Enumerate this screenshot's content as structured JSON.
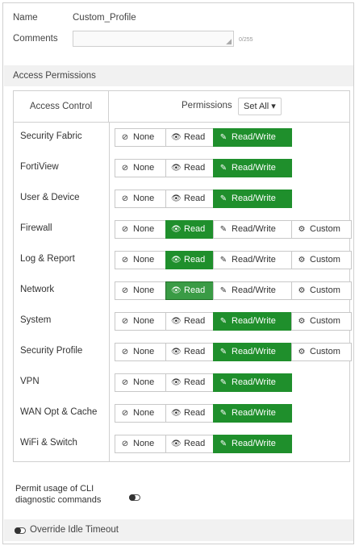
{
  "form": {
    "name_label": "Name",
    "name_value": "Custom_Profile",
    "comments_label": "Comments",
    "comments_value": "",
    "comments_counter": "0/255"
  },
  "access_section": {
    "title": "Access Permissions",
    "column_access": "Access Control",
    "column_permissions": "Permissions",
    "set_all_label": "Set All ▾"
  },
  "button_labels": {
    "none": "None",
    "read": "Read",
    "read_write": "Read/Write",
    "custom": "Custom"
  },
  "rows": [
    {
      "label": "Security Fabric",
      "selected": "read_write",
      "has_custom": false
    },
    {
      "label": "FortiView",
      "selected": "read_write",
      "has_custom": false
    },
    {
      "label": "User & Device",
      "selected": "read_write",
      "has_custom": false
    },
    {
      "label": "Firewall",
      "selected": "read",
      "has_custom": true
    },
    {
      "label": "Log & Report",
      "selected": "read",
      "has_custom": true
    },
    {
      "label": "Network",
      "selected": "read",
      "has_custom": true
    },
    {
      "label": "System",
      "selected": "read_write",
      "has_custom": true
    },
    {
      "label": "Security Profile",
      "selected": "read_write",
      "has_custom": true
    },
    {
      "label": "VPN",
      "selected": "read_write",
      "has_custom": false
    },
    {
      "label": "WAN Opt & Cache",
      "selected": "read_write",
      "has_custom": false
    },
    {
      "label": "WiFi & Switch",
      "selected": "read_write",
      "has_custom": false
    }
  ],
  "cli": {
    "label_line1": "Permit usage of CLI",
    "label_line2": "diagnostic commands",
    "enabled": false
  },
  "idle": {
    "label": "Override Idle Timeout",
    "enabled": false
  },
  "colors": {
    "active_green": "#1f8f2c",
    "header_gray": "#f1f1f1"
  }
}
